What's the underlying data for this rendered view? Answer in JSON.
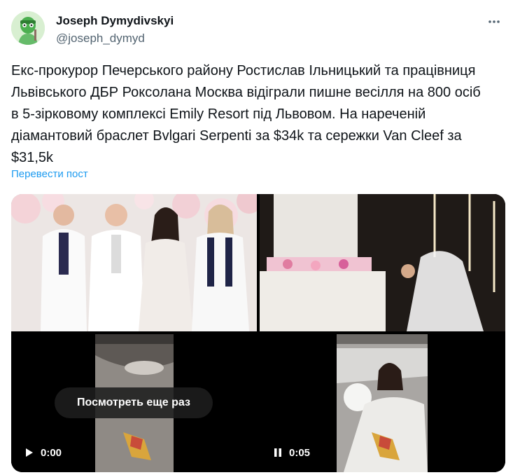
{
  "author": {
    "name": "Joseph Dymydivskyi",
    "handle": "@joseph_dymyd",
    "avatar_icon": "green-cartoon-avatar"
  },
  "more_icon": "ellipsis-icon",
  "tweet_text": "Екс-прокурор Печерського району Ростислав Ільницький та працівниця\nЛьвівського ДБР Роксолана Москва відіграли пишне весілля на 800 осіб\nв 5-зірковому комплексі Emily Resort під Львовом. На нареченій\nдіамантовий браслет Bvlgari Serpenti за $34k та сережки Van Cleef за\n$31,5k",
  "translate_label": "Перевести пост",
  "media": {
    "video1": {
      "replay_label": "Посмотреть еще раз",
      "control_icon": "play-icon",
      "time": "0:00"
    },
    "video2": {
      "control_icon": "pause-icon",
      "time": "0:05"
    }
  },
  "colors": {
    "link": "#1d9bf0",
    "secondary_text": "#536471",
    "text": "#0f1419"
  }
}
